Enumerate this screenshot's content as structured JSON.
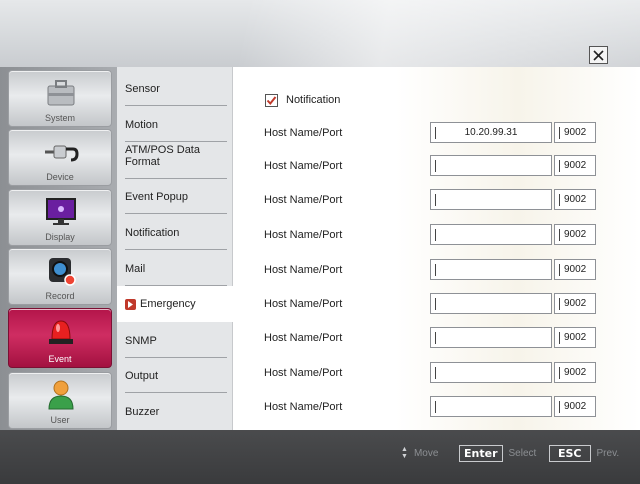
{
  "header": {
    "close_icon": "close-x-icon"
  },
  "categories": [
    {
      "label": "System",
      "icon": "toolbox-icon",
      "active": false
    },
    {
      "label": "Device",
      "icon": "plug-device-icon",
      "active": false
    },
    {
      "label": "Display",
      "icon": "monitor-icon",
      "active": false
    },
    {
      "label": "Record",
      "icon": "camera-record-icon",
      "active": false
    },
    {
      "label": "Event",
      "icon": "siren-icon",
      "active": true
    },
    {
      "label": "User",
      "icon": "user-icon",
      "active": false
    }
  ],
  "submenu": [
    {
      "label": "Sensor",
      "selected": false
    },
    {
      "label": "Motion",
      "selected": false
    },
    {
      "label": "ATM/POS Data Format",
      "selected": false
    },
    {
      "label": "Event Popup",
      "selected": false
    },
    {
      "label": "Notification",
      "selected": false
    },
    {
      "label": "Mail",
      "selected": false
    },
    {
      "label": "Emergency",
      "selected": true
    },
    {
      "label": "SNMP",
      "selected": false
    },
    {
      "label": "Output",
      "selected": false
    },
    {
      "label": "Buzzer",
      "selected": false
    }
  ],
  "main": {
    "notification_label": "Notification",
    "notification_checked": true,
    "hosts": [
      {
        "label": "Host Name/Port",
        "host": "10.20.99.31",
        "port": "9002"
      },
      {
        "label": "Host Name/Port",
        "host": "",
        "port": "9002"
      },
      {
        "label": "Host Name/Port",
        "host": "",
        "port": "9002"
      },
      {
        "label": "Host Name/Port",
        "host": "",
        "port": "9002"
      },
      {
        "label": "Host Name/Port",
        "host": "",
        "port": "9002"
      },
      {
        "label": "Host Name/Port",
        "host": "",
        "port": "9002"
      },
      {
        "label": "Host Name/Port",
        "host": "",
        "port": "9002"
      },
      {
        "label": "Host Name/Port",
        "host": "",
        "port": "9002"
      },
      {
        "label": "Host Name/Port",
        "host": "",
        "port": "9002"
      }
    ]
  },
  "footer": {
    "move_label": "Move",
    "enter_key": "Enter",
    "select_label": "Select",
    "esc_key": "ESC",
    "prev_label": "Prev."
  },
  "colors": {
    "accent": "#c21d52",
    "checkmark": "#c0392b"
  }
}
